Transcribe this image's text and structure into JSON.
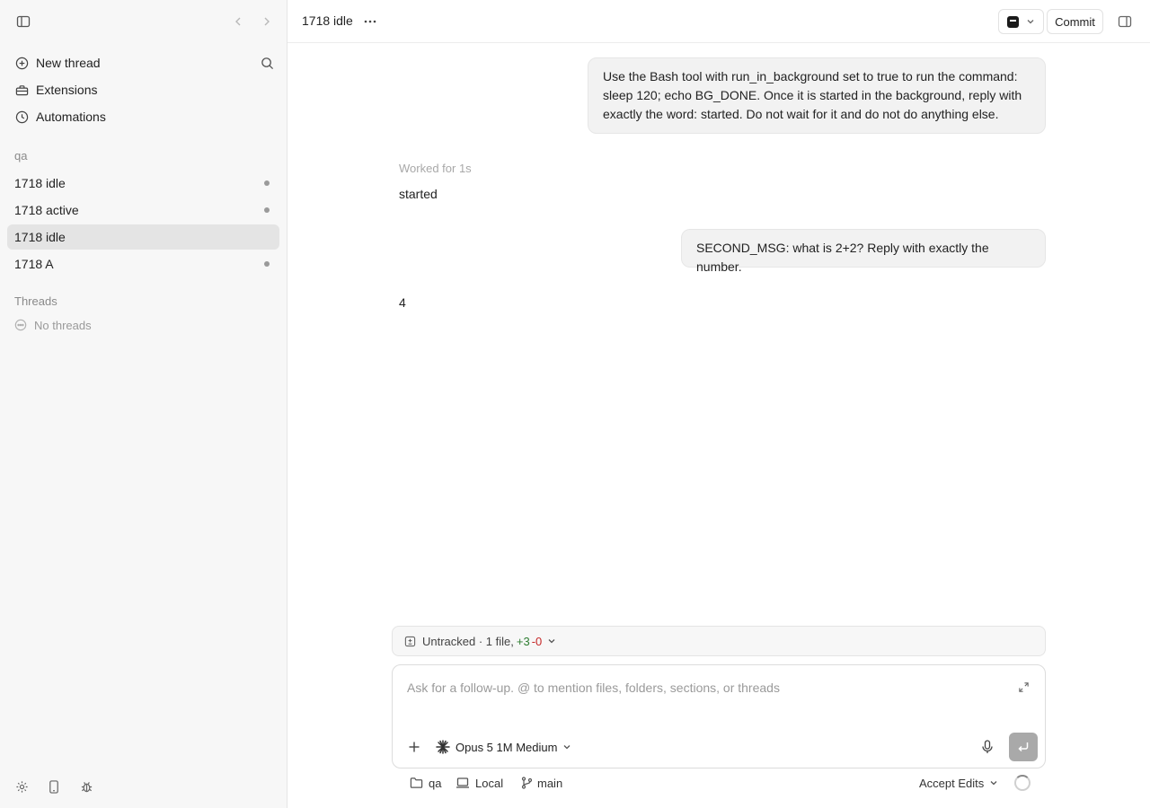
{
  "sidebar": {
    "nav": [
      {
        "label": "New thread",
        "icon": "plus-circle-icon"
      },
      {
        "label": "Extensions",
        "icon": "toolbox-icon"
      },
      {
        "label": "Automations",
        "icon": "clock-icon"
      }
    ],
    "project_label": "qa",
    "project_threads": [
      {
        "label": "1718 idle",
        "unread": true,
        "selected": false
      },
      {
        "label": "1718 active",
        "unread": true,
        "selected": false
      },
      {
        "label": "1718 idle",
        "unread": false,
        "selected": true
      },
      {
        "label": "1718 A",
        "unread": true,
        "selected": false
      }
    ],
    "threads_label": "Threads",
    "no_threads_label": "No threads"
  },
  "header": {
    "title": "1718 idle",
    "commit_label": "Commit"
  },
  "conversation": {
    "user_message_1": "Use the Bash tool with run_in_background set to true to run the command: sleep 120; echo BG_DONE. Once it is started in the background, reply with exactly the word: started. Do not wait for it and do not do anything else.",
    "worked_label": "Worked for 1s",
    "assistant_reply_1": "started",
    "user_message_2": "SECOND_MSG: what is 2+2? Reply with exactly the number.",
    "assistant_reply_2": "4"
  },
  "changes": {
    "label": "Untracked · 1 file,",
    "additions": "+3",
    "deletions": "-0"
  },
  "composer": {
    "placeholder": "Ask for a follow-up. @ to mention files, folders, sections, or threads",
    "value": "",
    "model_label": "Opus 5 1M Medium"
  },
  "footer": {
    "project": "qa",
    "environment": "Local",
    "branch": "main",
    "mode_label": "Accept Edits"
  },
  "colors": {
    "additions": "#2e7d32",
    "deletions": "#c62828",
    "selected_bg": "#e4e4e4",
    "send_button": "#a9a9a9"
  }
}
